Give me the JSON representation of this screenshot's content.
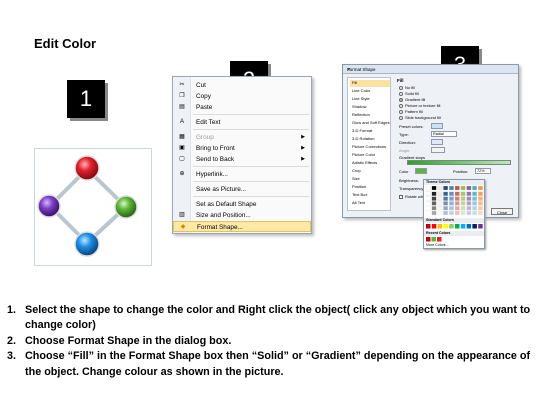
{
  "title": "Edit Color",
  "badges": [
    "1",
    "2",
    "3"
  ],
  "context_menu": {
    "items": [
      {
        "label": "Cut",
        "icon": "scissors-icon",
        "glyph": "✂",
        "disabled": false,
        "submenu": false
      },
      {
        "label": "Copy",
        "icon": "copy-icon",
        "glyph": "❐",
        "disabled": false,
        "submenu": false
      },
      {
        "label": "Paste",
        "icon": "paste-icon",
        "glyph": "▤",
        "disabled": false,
        "submenu": false
      },
      {
        "label": "Edit Text",
        "icon": "edit-text-icon",
        "glyph": "A",
        "disabled": false,
        "submenu": false
      },
      {
        "label": "Group",
        "icon": "group-icon",
        "glyph": "▦",
        "disabled": true,
        "submenu": true
      },
      {
        "label": "Bring to Front",
        "icon": "bring-front-icon",
        "glyph": "▣",
        "disabled": false,
        "submenu": true
      },
      {
        "label": "Send to Back",
        "icon": "send-back-icon",
        "glyph": "▢",
        "disabled": false,
        "submenu": true
      },
      {
        "label": "Hyperlink...",
        "icon": "hyperlink-icon",
        "glyph": "⊕",
        "disabled": false,
        "submenu": false
      },
      {
        "label": "Save as Picture...",
        "icon": "",
        "glyph": "",
        "disabled": false,
        "submenu": false
      },
      {
        "label": "Set as Default Shape",
        "icon": "",
        "glyph": "",
        "disabled": false,
        "submenu": false
      },
      {
        "label": "Size and Position...",
        "icon": "size-position-icon",
        "glyph": "▥",
        "disabled": false,
        "submenu": false
      },
      {
        "label": "Format Shape...",
        "icon": "format-shape-icon",
        "glyph": "◆",
        "disabled": false,
        "submenu": false
      }
    ]
  },
  "format_dialog": {
    "title": "Format Shape",
    "close_glyph": "✕",
    "categories": [
      "Fill",
      "Line Color",
      "Line Style",
      "Shadow",
      "Reflection",
      "Glow and Soft Edges",
      "3-D Format",
      "3-D Rotation",
      "Picture Corrections",
      "Picture Color",
      "Artistic Effects",
      "Crop",
      "Size",
      "Position",
      "Text Box",
      "Alt Text"
    ],
    "fill_heading": "Fill",
    "fill_options": [
      {
        "label": "No fill",
        "selected": false
      },
      {
        "label": "Solid fill",
        "selected": false
      },
      {
        "label": "Gradient fill",
        "selected": true
      },
      {
        "label": "Picture or texture fill",
        "selected": false
      },
      {
        "label": "Pattern fill",
        "selected": false
      },
      {
        "label": "Slide background fill",
        "selected": false
      }
    ],
    "fields": [
      "Preset colors:",
      "Type:",
      "Direction:",
      "Angle:"
    ],
    "type_value": "Radial",
    "gradient_stops_label": "Gradient stops",
    "color_label": "Color",
    "brightness_label": "Brightness:",
    "transparency_label": "Transparency:",
    "rotate_label": "Rotate with shape",
    "position_label": "Position:",
    "position_value": "72%",
    "palette_headers": [
      "Theme Colors",
      "Standard Colors",
      "Recent Colors"
    ],
    "palette_footer": "More Colors...",
    "close_button": "Close"
  },
  "instructions": [
    {
      "num": "1.",
      "text": "Select the shape to change the color and Right click the object( click any object which you want to change color)"
    },
    {
      "num": "2.",
      "text": "Choose Format Shape in the dialog box."
    },
    {
      "num": "3.",
      "text": "Choose “Fill” in the Format Shape box then “Solid” or “Gradient” depending on the appearance of the object. Change colour as shown in the picture."
    }
  ],
  "colors": {
    "node_top": "#e2202c",
    "node_left": "#7e3fc7",
    "node_right": "#5fb43a",
    "node_bottom": "#1e8fe6",
    "active_item": "#fde8a6"
  }
}
